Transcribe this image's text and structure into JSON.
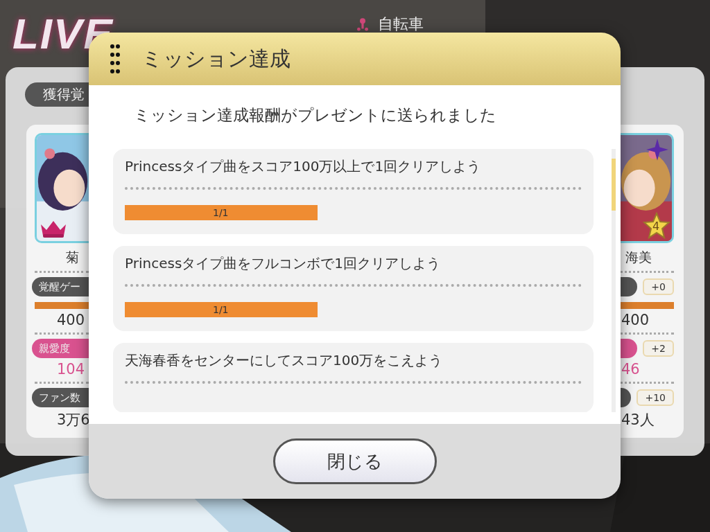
{
  "background": {
    "kind": "picture",
    "title": "LIVE",
    "song": "自転車"
  },
  "report_panel": {
    "tab": "獲得覚",
    "cards": [
      {
        "name": "菊",
        "badge": {
          "kind": "crown"
        },
        "rows": [
          {
            "kind": "gauge",
            "label": "覚醒ゲー",
            "level": 1,
            "value": "400"
          },
          {
            "kind": "affection",
            "label": "親愛度",
            "value": "104"
          },
          {
            "kind": "fans",
            "label": "ファン数",
            "value": "3万6"
          }
        ]
      },
      {
        "name": "海美",
        "badge": {
          "kind": "star",
          "rank": "4"
        },
        "rows": [
          {
            "kind": "gauge",
            "bonus": "+0",
            "level": 1,
            "value": "400"
          },
          {
            "kind": "affection",
            "bonus": "+2",
            "value": "46"
          },
          {
            "kind": "fans",
            "bonus": "+10",
            "value": "43人"
          }
        ]
      }
    ]
  },
  "dialog": {
    "title": "ミッション達成",
    "message": "ミッション達成報酬がプレゼントに送られました",
    "missions": [
      {
        "text": "Princessタイプ曲をスコア100万以上で1回クリアしよう",
        "progress": {
          "level": 1,
          "label": "1/1"
        }
      },
      {
        "text": "Princessタイプ曲をフルコンボで1回クリアしよう",
        "progress": {
          "level": 1,
          "label": "1/1"
        }
      },
      {
        "text": "天海春香をセンターにしてスコア100万をこえよう"
      }
    ],
    "close_button": "閉じる"
  }
}
